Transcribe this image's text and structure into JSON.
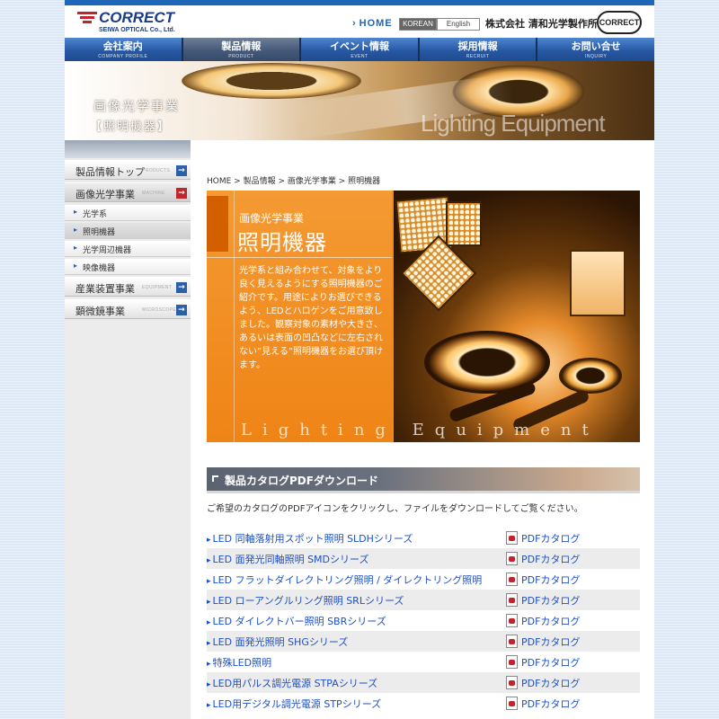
{
  "header": {
    "logo_text": "CORRECT",
    "logo_sub": "SEIWA OPTICAL Co., Ltd.",
    "home_link": "HOME",
    "lang_korean": "KOREAN",
    "lang_english": "English",
    "company_name": "株式会社 清和光学製作所",
    "stamp_text": "CORRECT"
  },
  "nav": [
    {
      "label": "会社案内",
      "sub": "COMPANY PROFILE"
    },
    {
      "label": "製品情報",
      "sub": "PRODUCT"
    },
    {
      "label": "イベント情報",
      "sub": "EVENT"
    },
    {
      "label": "採用情報",
      "sub": "RECRUIT"
    },
    {
      "label": "お問い合せ",
      "sub": "INQUIRY"
    }
  ],
  "hero": {
    "title": "画像光学事業",
    "subtitle": "【照明機器】",
    "english": "Lighting Equipment"
  },
  "sidebar": {
    "items": [
      {
        "label": "製品情報トップ",
        "en": "PRODUCTS"
      },
      {
        "label": "画像光学事業",
        "en": "MACHINE"
      },
      {
        "label": "光学系"
      },
      {
        "label": "照明機器"
      },
      {
        "label": "光学周辺機器"
      },
      {
        "label": "映像機器"
      },
      {
        "label": "産業装置事業",
        "en": "EQUIPMENT"
      },
      {
        "label": "顕微鏡事業",
        "en": "MICROSCOPE"
      }
    ]
  },
  "breadcrumb": {
    "home": "HOME",
    "sep": " > ",
    "level1": "製品情報",
    "level2": "画像光学事業",
    "current": "照明機器"
  },
  "feature": {
    "small": "画像光学事業",
    "big": "照明機器",
    "description": "光学系と組み合わせて、対象をより良く見えるようにする照明機器のご紹介です。用途によりお選びできるよう、LEDとハロゲンをご用意致しました。観察対象の素材や大きさ、あるいは表面の凹凸などに左右されない”見える”照明機器をお選び頂けます。",
    "english": "Lighting Equipment"
  },
  "catalog_section": {
    "title": "製品カタログPDFダウンロード",
    "intro": "ご希望のカタログのPDFアイコンをクリックし、ファイルをダウンロードしてご覧ください。",
    "pdf_label": "PDFカタログ",
    "rows": [
      {
        "name": "LED 同軸落射用スポット照明 SLDHシリーズ"
      },
      {
        "name": "LED 面発光同軸照明 SMDシリーズ"
      },
      {
        "name": "LED フラットダイレクトリング照明 / ダイレクトリング照明"
      },
      {
        "name": "LED ローアングルリング照明 SRLシリーズ"
      },
      {
        "name": "LED ダイレクトバー照明 SBRシリーズ"
      },
      {
        "name": "LED 面発光照明 SHGシリーズ"
      },
      {
        "name": "特殊LED照明"
      },
      {
        "name": "LED用パルス調光電源 STPAシリーズ"
      },
      {
        "name": "LED用デジタル調光電源 STPシリーズ"
      }
    ]
  },
  "colors": {
    "brand_blue": "#1e66b8",
    "brand_red": "#c0242c",
    "feature_orange": "#f08a1c",
    "link_blue": "#1d50c8"
  }
}
